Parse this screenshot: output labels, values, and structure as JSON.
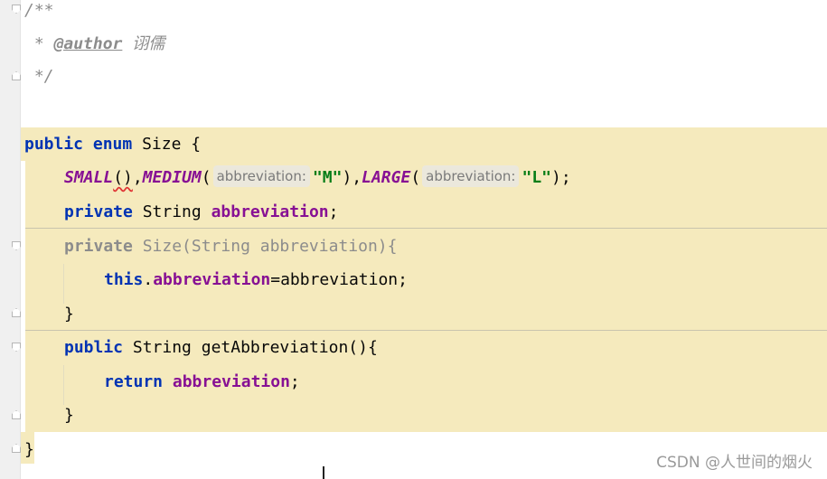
{
  "code": {
    "doc_open": "/**",
    "doc_star": " * ",
    "doc_tag": "@author",
    "doc_author": " 诩儒",
    "doc_close": " */",
    "l_public": "public",
    "l_enum": "enum",
    "l_size": "Size",
    "l_brace_open": "{",
    "c_small": "SMALL",
    "c_small_parens": "()",
    "comma": ",",
    "c_medium": "MEDIUM",
    "paren_open": "(",
    "hint_label": "abbreviation:",
    "str_m": "\"M\"",
    "c_large": "LARGE",
    "str_l": "\"L\"",
    "paren_close_semi": ");",
    "f_private": "private",
    "f_type": "String",
    "f_name": "abbreviation",
    "semi": ";",
    "ctor_private": "private",
    "ctor_sig": "Size(String abbreviation){",
    "this_kw": "this",
    "dot": ".",
    "assign_rhs": "=abbreviation;",
    "brace_close": "}",
    "m_public": "public",
    "m_sig": "String getAbbreviation(){",
    "ret_kw": "return",
    "ret_field": "abbreviation"
  },
  "watermark": "CSDN @人世间的烟火"
}
